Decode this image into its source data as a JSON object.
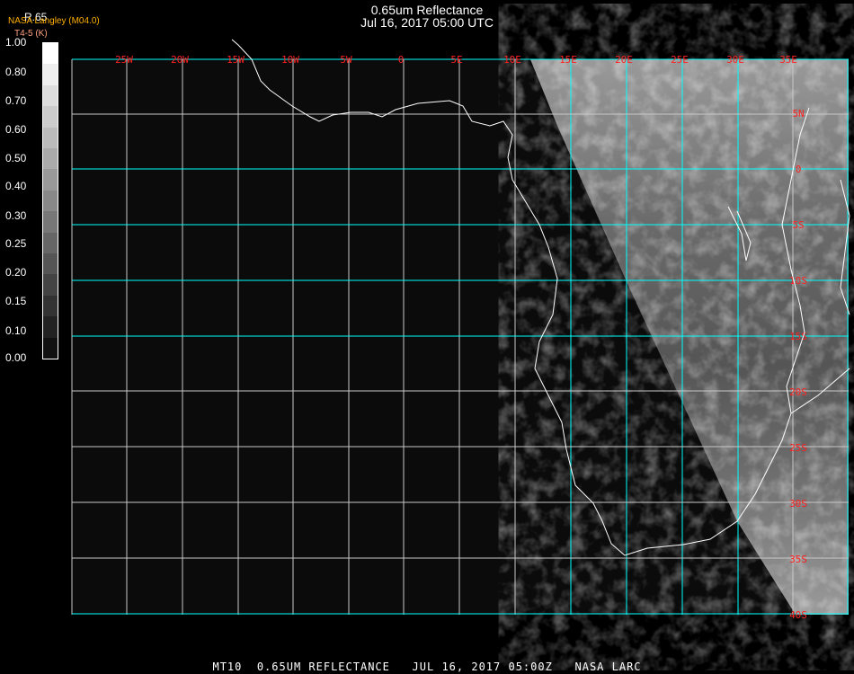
{
  "header": {
    "title": "0.65um Reflectance",
    "datetime": "Jul 16, 2017 05:00 UTC"
  },
  "legend": {
    "variable": "R.65",
    "source": "NASA Langley (M04.0)",
    "unit": "T4-5 (K)",
    "ticks": [
      "1.00",
      "0.80",
      "0.70",
      "0.60",
      "0.50",
      "0.40",
      "0.30",
      "0.25",
      "0.20",
      "0.15",
      "0.10",
      "0.00"
    ],
    "colors": [
      "#ffffff",
      "#eeeeee",
      "#dddddd",
      "#cccccc",
      "#bbbbbb",
      "#aaaaaa",
      "#999999",
      "#888888",
      "#777777",
      "#666666",
      "#555555",
      "#444444",
      "#333333",
      "#222222",
      "#111111"
    ]
  },
  "map": {
    "lon_labels": [
      "25W",
      "20W",
      "15W",
      "10W",
      "5W",
      "0",
      "5E",
      "10E",
      "15E",
      "20E",
      "25E",
      "30E",
      "35E"
    ],
    "lat_labels": [
      "5N",
      "0",
      "5S",
      "10S",
      "15S",
      "20S",
      "25S",
      "30S",
      "35S",
      "40S"
    ],
    "grid_color": "#00ffff",
    "label_color": "#ff2020"
  },
  "footer": {
    "text": "MT10  0.65UM REFLECTANCE   JUL 16, 2017 05:00Z   NASA LARC"
  }
}
